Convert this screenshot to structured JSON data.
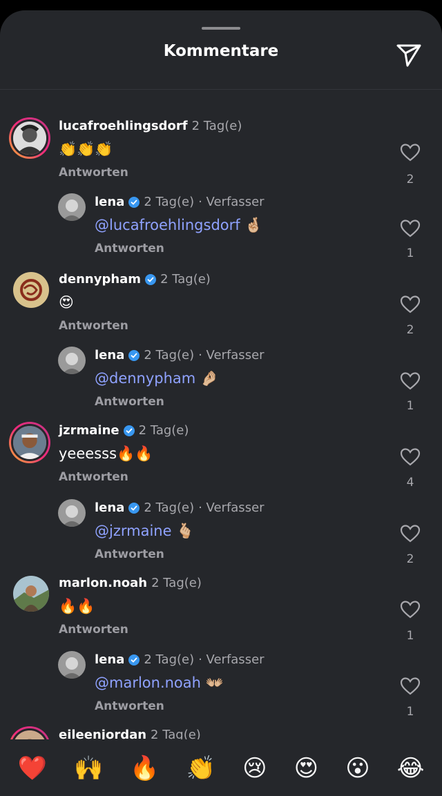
{
  "header": {
    "title": "Kommentare",
    "send_icon": "paper-plane-icon"
  },
  "comments": [
    {
      "user": "lucafroehlingsdorf",
      "verified": false,
      "time": "2 Tag(e)",
      "author_tag": "",
      "text": "👏👏👏",
      "mention": "",
      "reply": "Antworten",
      "likes": "2"
    },
    {
      "user": "lena",
      "verified": true,
      "time": "2 Tag(e)",
      "author_tag": "· Verfasser",
      "text": "🤞🏼",
      "mention": "@lucafroehlingsdorf",
      "reply": "Antworten",
      "likes": "1"
    },
    {
      "user": "dennypham",
      "verified": true,
      "time": "2 Tag(e)",
      "author_tag": "",
      "text": "😍",
      "mention": "",
      "reply": "Antworten",
      "likes": "2"
    },
    {
      "user": "lena",
      "verified": true,
      "time": "2 Tag(e)",
      "author_tag": "· Verfasser",
      "text": "🤌🏼",
      "mention": "@dennypham",
      "reply": "Antworten",
      "likes": "1"
    },
    {
      "user": "jzrmaine",
      "verified": true,
      "time": "2 Tag(e)",
      "author_tag": "",
      "text": "yeeesss🔥🔥",
      "mention": "",
      "reply": "Antworten",
      "likes": "4"
    },
    {
      "user": "lena",
      "verified": true,
      "time": "2 Tag(e)",
      "author_tag": "· Verfasser",
      "text": "🫰🏼",
      "mention": "@jzrmaine",
      "reply": "Antworten",
      "likes": "2"
    },
    {
      "user": "marlon.noah",
      "verified": false,
      "time": "2 Tag(e)",
      "author_tag": "",
      "text": "🔥🔥",
      "mention": "",
      "reply": "Antworten",
      "likes": "1"
    },
    {
      "user": "lena",
      "verified": true,
      "time": "2 Tag(e)",
      "author_tag": "· Verfasser",
      "text": "👐🏼",
      "mention": "@marlon.noah",
      "reply": "Antworten",
      "likes": "1"
    },
    {
      "user": "eileenjordan",
      "verified": false,
      "time": "2 Tag(e)",
      "author_tag": "",
      "text": "",
      "mention": "",
      "reply": "",
      "likes": ""
    }
  ],
  "reactions": [
    "❤️",
    "🙌",
    "🔥",
    "👏",
    "😢",
    "😍",
    "😮",
    "😂"
  ],
  "colors": {
    "background": "#25272b",
    "mention": "#8fa2ff",
    "verified": "#3897f0",
    "muted": "#a8a8ad"
  }
}
